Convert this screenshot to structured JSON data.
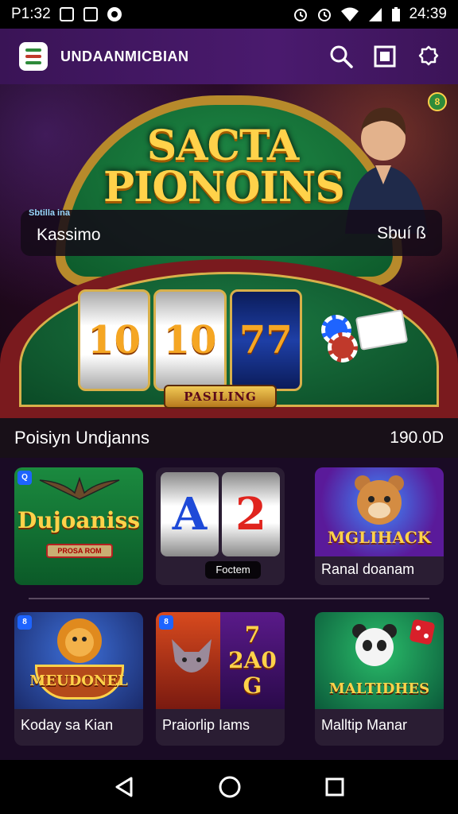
{
  "status_bar": {
    "time_left": "P1:32",
    "time_right": "24:39",
    "icons_left": [
      "photo-icon",
      "grid-icon",
      "circle-icon"
    ],
    "icons_right": [
      "alarm-icon",
      "alarm-icon",
      "wifi-icon",
      "signal-icon",
      "battery-icon"
    ]
  },
  "app_bar": {
    "title": "UNDAANMICBIAN",
    "actions": [
      "search-icon",
      "square-icon",
      "settings-icon"
    ]
  },
  "hero": {
    "title_line1": "SACTA",
    "title_line2": "PIONOINS",
    "badge": "8",
    "card_tag": "Sbtilla ina",
    "card_name": "Kassimo",
    "card_side": "Sbuí ß",
    "reels": [
      "10",
      "10",
      "77"
    ],
    "plate": "PASILING"
  },
  "section": {
    "title": "Poisiyn Undjanns",
    "value": "190.0D"
  },
  "games": [
    {
      "badge": "Q",
      "art_title": "Dujoaniss",
      "pill": "PROSA ROM",
      "label": ""
    },
    {
      "badge": "",
      "art_title": "A 2",
      "pill": "Foctem",
      "label": ""
    },
    {
      "badge": "",
      "art_title": "MGLIHACK",
      "pill": "",
      "label": "Ranal doanam"
    },
    {
      "badge": "8",
      "art_title": "MEUDONEL",
      "pill": "",
      "label": "Koday sa Kian"
    },
    {
      "badge": "8",
      "art_title": "7 2A0G",
      "pill": "",
      "label": "Praiorlip Iams"
    },
    {
      "badge": "",
      "art_title": "MALTIDHES",
      "pill": "",
      "label": "Malltip Manar"
    }
  ],
  "colors": {
    "app_bar": "#4a1a6e",
    "gold": "#ffd24a",
    "grid_bg": "#1a0b25"
  },
  "nav": [
    "back-icon",
    "home-icon",
    "recents-icon"
  ]
}
